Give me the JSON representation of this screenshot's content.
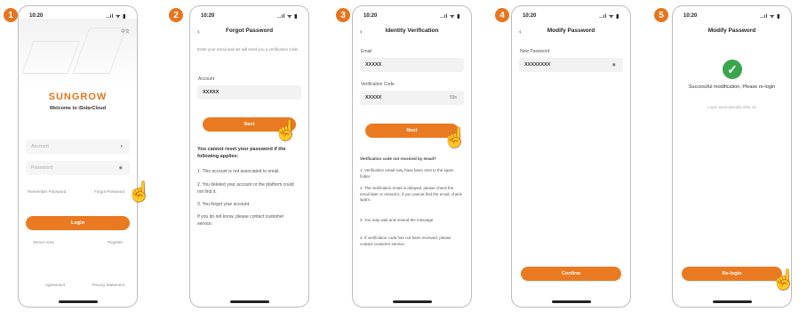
{
  "badges": [
    "1",
    "2",
    "3",
    "4",
    "5"
  ],
  "status_bar": {
    "time": "10:20",
    "signal": "..ıl ᯤ ▮"
  },
  "screen1": {
    "top_right": "中文",
    "logo": "SUNGROW",
    "welcome": "Welcome to iSolarCloud",
    "account_placeholder": "Account",
    "password_placeholder": "Password",
    "remember_label": "Remember Password",
    "forgot_link": "Forgot Password",
    "login_button": "Login",
    "left_link": "Server Area",
    "right_link": "Register",
    "footer_left": "Agreement",
    "footer_right": "Privacy Statement"
  },
  "screen2": {
    "title": "Forgot Password",
    "intro": "Enter your email and we will send you a verification code",
    "account_label": "Account",
    "account_value": "XXXXX",
    "next_button": "Next",
    "help_title": "You cannot reset your password if the following applies:",
    "help_items": [
      "1. This account is not associated to email.",
      "2. You deleted your account or the platform could not find it.",
      "3. You forgot your account.",
      "If you do not know, please contact customer service."
    ]
  },
  "screen3": {
    "title": "Identity Verification",
    "email_label": "Email",
    "email_value": "XXXXX",
    "code_label": "Verification Code",
    "code_value": "XXXXX",
    "code_tail": "59s",
    "next_button": "Next",
    "help_title": "Verification code not received by email?",
    "help_items": [
      "1. Verification email may have been sent to the spam folder.",
      "2. The verification email is delayed, please check the email later or resend it; if you cannot find the email, check spam.",
      "3. You may wait and resend the message.",
      "4. If verification code has not been received, please contact customer service."
    ]
  },
  "screen4": {
    "title": "Modify Password",
    "password_label": "New Password",
    "password_value": "XXXXXXXX",
    "confirm_button": "Confirm"
  },
  "screen5": {
    "title": "Modify Password",
    "success_text": "Successful modification, Please re-login",
    "sub_text": "Login automatically after 3s",
    "login_button": "Re-login"
  }
}
